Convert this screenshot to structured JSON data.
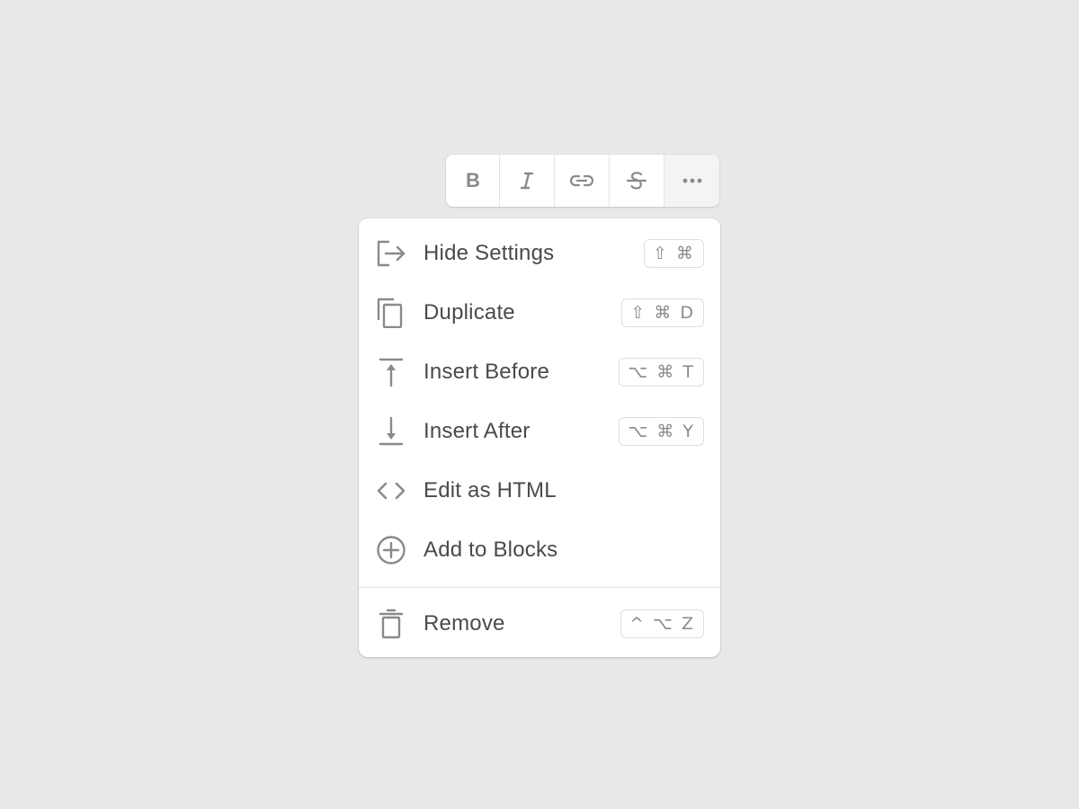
{
  "toolbar": {
    "buttons": [
      {
        "name": "bold",
        "icon": "bold-icon"
      },
      {
        "name": "italic",
        "icon": "italic-icon"
      },
      {
        "name": "link",
        "icon": "link-icon"
      },
      {
        "name": "strikethrough",
        "icon": "strikethrough-icon"
      },
      {
        "name": "more",
        "icon": "more-horizontal-icon"
      }
    ]
  },
  "menu": {
    "items": [
      {
        "label": "Hide Settings",
        "shortcut": "⇧ ⌘",
        "icon": "exit-icon"
      },
      {
        "label": "Duplicate",
        "shortcut": "⇧ ⌘ D",
        "icon": "copy-icon"
      },
      {
        "label": "Insert Before",
        "shortcut": "⌥ ⌘ T",
        "icon": "arrow-up-to-line-icon"
      },
      {
        "label": "Insert After",
        "shortcut": "⌥ ⌘ Y",
        "icon": "arrow-down-to-line-icon"
      },
      {
        "label": "Edit as HTML",
        "shortcut": "",
        "icon": "code-icon"
      },
      {
        "label": "Add to Blocks",
        "shortcut": "",
        "icon": "plus-circle-icon"
      }
    ],
    "remove": {
      "label": "Remove",
      "shortcut": "^ ⌥ Z",
      "icon": "trash-icon"
    }
  },
  "colors": {
    "background": "#e8e8e8",
    "surface": "#ffffff",
    "text": "#4a4a4a",
    "icon": "#8a8a8a",
    "border": "#dedede"
  }
}
